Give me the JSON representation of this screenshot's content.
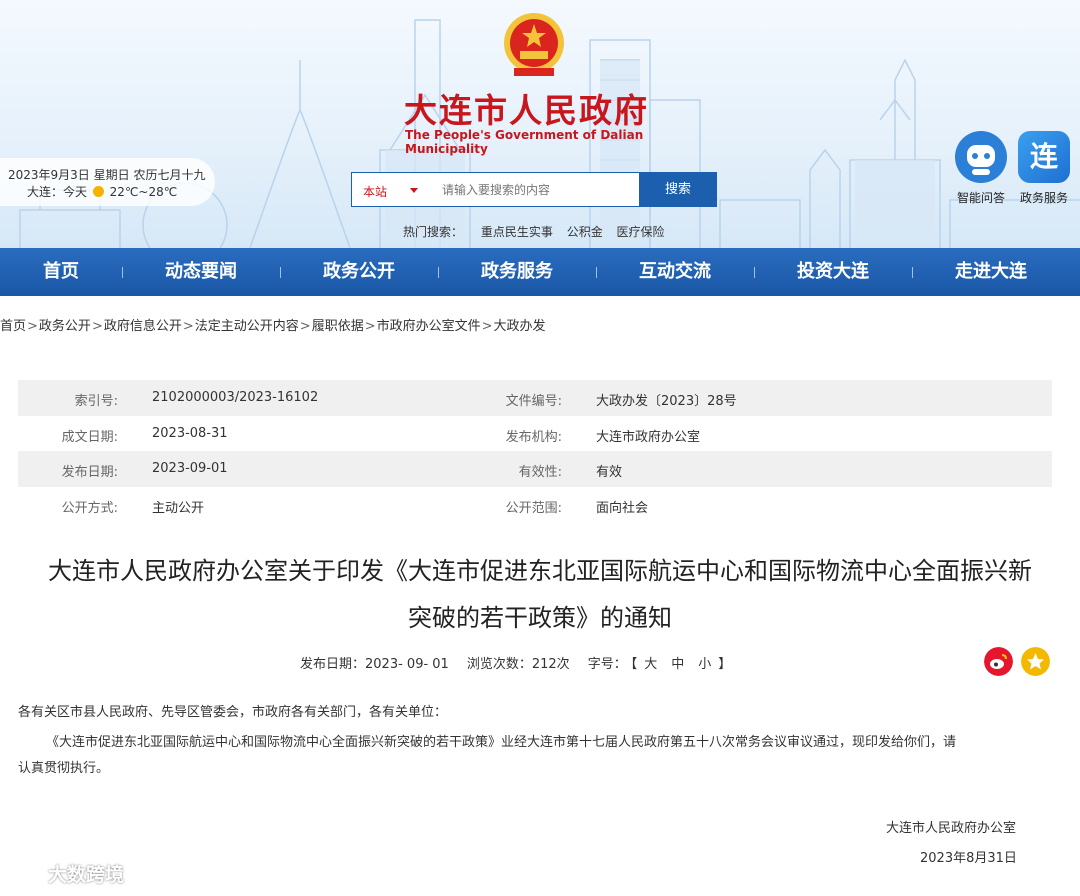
{
  "header": {
    "title": "大连市人民政府",
    "subtitle": "The People's Government of Dalian Municipality",
    "date_line": "2023年9月3日 星期日 农历七月十九",
    "weather_city": "大连：今天",
    "weather_temp": "22℃~28℃",
    "search": {
      "scope": "本站",
      "placeholder": "请输入要搜索的内容",
      "button": "搜索"
    },
    "hot_search": {
      "label": "热门搜索：",
      "items": [
        "重点民生实事",
        "公积金",
        "医疗保险"
      ]
    },
    "side_icons": [
      {
        "label": "智能问答",
        "icon": "robot-icon"
      },
      {
        "label": "政务服务",
        "icon": "lian-icon",
        "glyph": "连"
      }
    ],
    "colors": {
      "brand_red": "#c8161d",
      "nav_blue": "#1a57a6"
    }
  },
  "nav": [
    "首页",
    "动态要闻",
    "政务公开",
    "政务服务",
    "互动交流",
    "投资大连",
    "走进大连"
  ],
  "breadcrumb": [
    "首页",
    "政务公开",
    "政府信息公开",
    "法定主动公开内容",
    "履职依据",
    "市政府办公室文件",
    "大政办发"
  ],
  "meta": [
    {
      "k1": "索引号:",
      "v1": "2102000003/2023-16102",
      "k2": "文件编号:",
      "v2": "大政办发〔2023〕28号"
    },
    {
      "k1": "成文日期:",
      "v1": "2023-08-31",
      "k2": "发布机构:",
      "v2": "大连市政府办公室"
    },
    {
      "k1": "发布日期:",
      "v1": "2023-09-01",
      "k2": "有效性:",
      "v2": "有效"
    },
    {
      "k1": "公开方式:",
      "v1": "主动公开",
      "k2": "公开范围:",
      "v2": "面向社会"
    }
  ],
  "doc": {
    "title_line1": "大连市人民政府办公室关于印发《大连市促进东北亚国际航运中心和国际物流中心全面振兴新",
    "title_line2": "突破的若干政策》的通知",
    "pub_label": "发布日期：",
    "pub_date": "2023- 09- 01",
    "views_label": "浏览次数：",
    "views": "212次",
    "font_label": "字号：",
    "bracket_open": "【",
    "font_large": "大",
    "font_medium": "中",
    "font_small": "小",
    "bracket_close": "】",
    "salutation": "各有关区市县人民政府、先导区管委会，市政府各有关部门，各有关单位：",
    "para1_line1": "《大连市促进东北亚国际航运中心和国际物流中心全面振兴新突破的若干政策》业经大连市第十七届人民政府第五十八次常务会议审议通过，现印发给你们，请",
    "para1_line2": "认真贯彻执行。",
    "sign_org": "大连市人民政府办公室",
    "sign_date": "2023年8月31日"
  },
  "watermark": "大数跨境"
}
